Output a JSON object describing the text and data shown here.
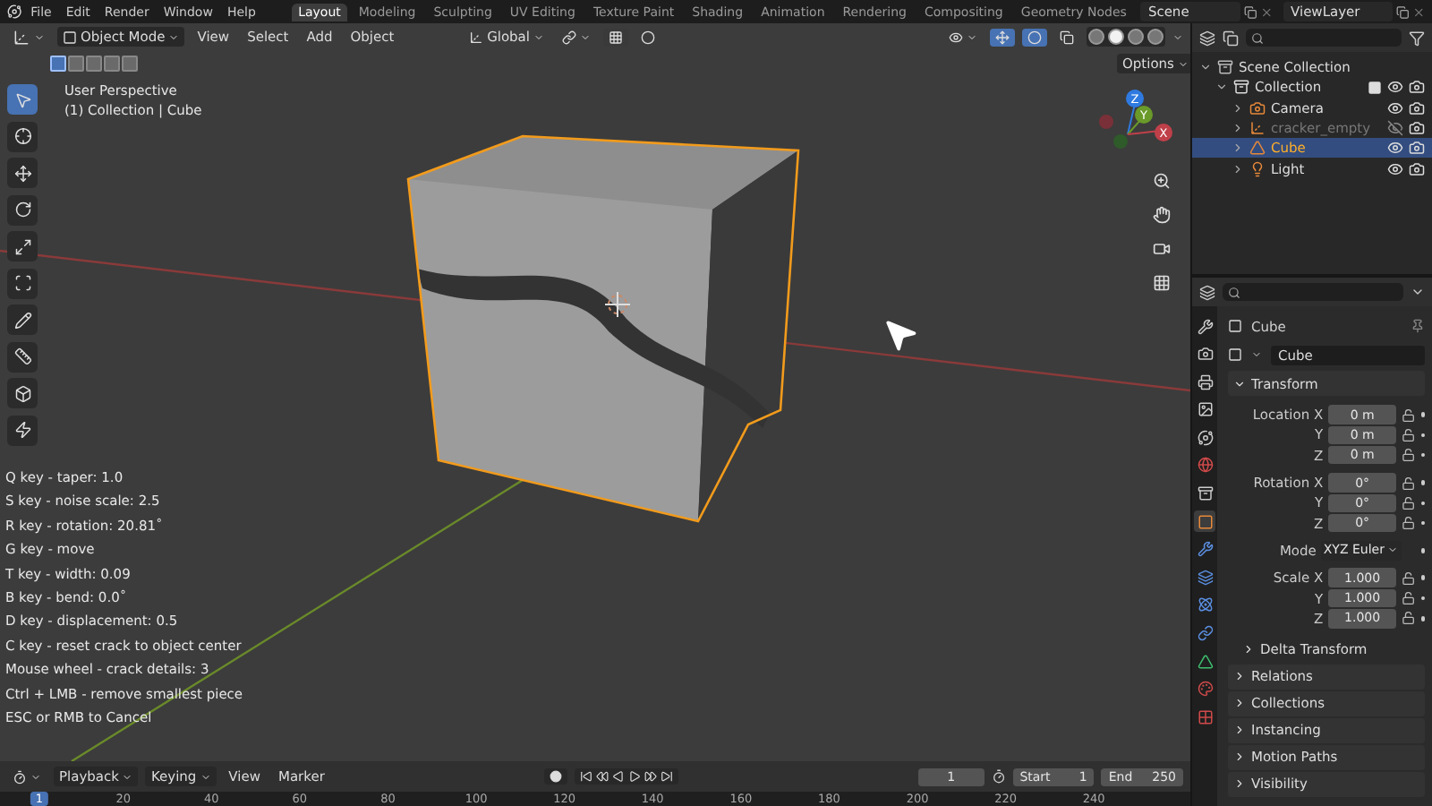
{
  "menu": [
    "File",
    "Edit",
    "Render",
    "Window",
    "Help"
  ],
  "workspaces": [
    {
      "label": "Layout",
      "selected": true
    },
    {
      "label": "Modeling",
      "selected": false
    },
    {
      "label": "Sculpting",
      "selected": false
    },
    {
      "label": "UV Editing",
      "selected": false
    },
    {
      "label": "Texture Paint",
      "selected": false
    },
    {
      "label": "Shading",
      "selected": false
    },
    {
      "label": "Animation",
      "selected": false
    },
    {
      "label": "Rendering",
      "selected": false
    },
    {
      "label": "Compositing",
      "selected": false
    },
    {
      "label": "Geometry Nodes",
      "selected": false
    }
  ],
  "scene": "Scene",
  "view_layer": "ViewLayer",
  "viewport": {
    "mode": "Object Mode",
    "menus": [
      "View",
      "Select",
      "Add",
      "Object"
    ],
    "orientation": "Global",
    "options": "Options",
    "select_modes": [
      {
        "selected": true
      },
      {
        "selected": false
      },
      {
        "selected": false
      },
      {
        "selected": false
      },
      {
        "selected": false
      }
    ],
    "shading": [
      {
        "selected": false
      },
      {
        "selected": true
      },
      {
        "selected": false
      },
      {
        "selected": false
      }
    ],
    "tools": [
      {
        "kind": "select",
        "selected": true
      },
      {
        "kind": "cursor",
        "selected": false
      },
      {
        "kind": "move",
        "selected": false
      },
      {
        "kind": "rotate",
        "selected": false
      },
      {
        "kind": "scale",
        "selected": false
      },
      {
        "kind": "transform",
        "selected": false
      },
      {
        "kind": "annotate",
        "selected": false
      },
      {
        "kind": "measure",
        "selected": false
      },
      {
        "kind": "add",
        "selected": false
      },
      {
        "kind": "addon",
        "selected": false
      }
    ],
    "view_info": [
      "User Perspective",
      "(1) Collection | Cube"
    ],
    "hints": [
      "Q key - taper: 1.0",
      "S key - noise scale:  2.5",
      "R key - rotation:  20.81˚",
      "G key - move",
      "T key - width:  0.09",
      "B key - bend:  0.0˚",
      "D key - displacement:  0.5",
      "C key - reset crack to object center",
      "Mouse wheel - crack details:  3",
      "Ctrl + LMB - remove smallest piece",
      "ESC or RMB to Cancel"
    ],
    "gizmo": [
      "X",
      "Y",
      "Z"
    ]
  },
  "outliner": {
    "items": [
      {
        "label": "Scene Collection",
        "kind": "scene",
        "selected": false,
        "children": [
          {
            "label": "Collection",
            "kind": "collection",
            "selected": false,
            "checked": true,
            "visible": true,
            "children": [
              {
                "label": "Camera",
                "kind": "camera",
                "selected": false,
                "visible": true
              },
              {
                "label": "cracker_empty",
                "kind": "empty",
                "selected": false,
                "visible": false
              },
              {
                "label": "Cube",
                "kind": "mesh",
                "selected": true,
                "visible": true
              },
              {
                "label": "Light",
                "kind": "light",
                "selected": false,
                "visible": true
              }
            ]
          }
        ]
      }
    ]
  },
  "properties": {
    "tabs": [
      {
        "kind": "tool",
        "selected": false
      },
      {
        "kind": "render",
        "selected": false
      },
      {
        "kind": "output",
        "selected": false
      },
      {
        "kind": "view_layer",
        "selected": false
      },
      {
        "kind": "scene",
        "selected": false
      },
      {
        "kind": "world",
        "selected": false
      },
      {
        "kind": "collection",
        "selected": false
      },
      {
        "kind": "object",
        "selected": true
      },
      {
        "kind": "modifier",
        "selected": false
      },
      {
        "kind": "particles",
        "selected": false
      },
      {
        "kind": "physics",
        "selected": false
      },
      {
        "kind": "constraints",
        "selected": false
      },
      {
        "kind": "data",
        "selected": false
      },
      {
        "kind": "material",
        "selected": false
      },
      {
        "kind": "texture",
        "selected": false
      }
    ],
    "object": "Cube",
    "data_name": "Cube",
    "transform": {
      "title": "Transform",
      "expanded": true,
      "groups": [
        {
          "kind": "vector",
          "rows": [
            {
              "label": "Location X",
              "value": "0 m"
            },
            {
              "label": "Y",
              "value": "0 m"
            },
            {
              "label": "Z",
              "value": "0 m"
            }
          ]
        },
        {
          "kind": "vector",
          "rows": [
            {
              "label": "Rotation X",
              "value": "0°"
            },
            {
              "label": "Y",
              "value": "0°"
            },
            {
              "label": "Z",
              "value": "0°"
            }
          ]
        },
        {
          "kind": "dropdown",
          "label": "Mode",
          "value": "XYZ Euler"
        },
        {
          "kind": "vector",
          "rows": [
            {
              "label": "Scale X",
              "value": "1.000"
            },
            {
              "label": "Y",
              "value": "1.000"
            },
            {
              "label": "Z",
              "value": "1.000"
            }
          ]
        }
      ],
      "subpanels": [
        {
          "title": "Delta Transform",
          "expanded": false
        }
      ]
    },
    "panels": [
      {
        "title": "Relations",
        "expanded": false
      },
      {
        "title": "Collections",
        "expanded": false
      },
      {
        "title": "Instancing",
        "expanded": false
      },
      {
        "title": "Motion Paths",
        "expanded": false
      },
      {
        "title": "Visibility",
        "expanded": false
      }
    ]
  },
  "timeline": {
    "menus": [
      "Playback",
      "Keying",
      "View",
      "Marker"
    ],
    "frame": "1",
    "start_label": "Start",
    "start": "1",
    "end_label": "End",
    "end": "250",
    "current": "1",
    "ticks": [
      "20",
      "40",
      "60",
      "80",
      "100",
      "120",
      "140",
      "160",
      "180",
      "200",
      "220",
      "240"
    ]
  }
}
